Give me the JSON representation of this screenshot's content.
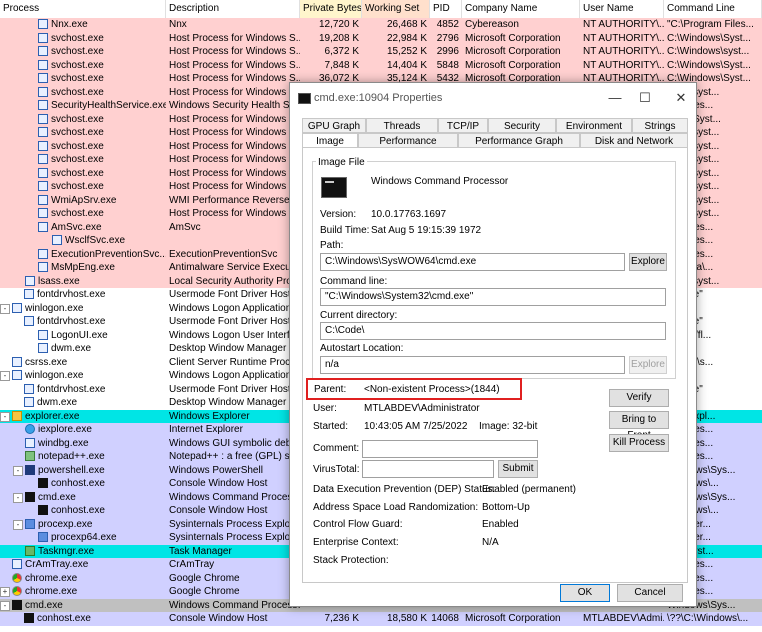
{
  "columns": {
    "process": "Process",
    "description": "Description",
    "private_bytes": "Private Bytes",
    "working_set": "Working Set",
    "pid": "PID",
    "company": "Company Name",
    "user": "User Name",
    "cmdline": "Command Line"
  },
  "rows": [
    {
      "name": "Nnx.exe",
      "desc": "Nnx",
      "pb": "12,720 K",
      "ws": "26,468 K",
      "pid": "4852",
      "company": "Cybereason",
      "user": "NT AUTHORITY\\...",
      "cmd": "\"C:\\Program Files..."
    },
    {
      "name": "svchost.exe",
      "desc": "Host Process for Windows S...",
      "pb": "19,208 K",
      "ws": "22,984 K",
      "pid": "2796",
      "company": "Microsoft Corporation",
      "user": "NT AUTHORITY\\...",
      "cmd": "C:\\Windows\\Syst..."
    },
    {
      "name": "svchost.exe",
      "desc": "Host Process for Windows S...",
      "pb": "6,372 K",
      "ws": "15,252 K",
      "pid": "2996",
      "company": "Microsoft Corporation",
      "user": "NT AUTHORITY\\...",
      "cmd": "C:\\Windows\\syst..."
    },
    {
      "name": "svchost.exe",
      "desc": "Host Process for Windows S...",
      "pb": "7,848 K",
      "ws": "14,404 K",
      "pid": "5848",
      "company": "Microsoft Corporation",
      "user": "NT AUTHORITY\\...",
      "cmd": "C:\\Windows\\Syst..."
    },
    {
      "name": "svchost.exe",
      "desc": "Host Process for Windows S...",
      "pb": "36,072 K",
      "ws": "35,124 K",
      "pid": "5432",
      "company": "Microsoft Corporation",
      "user": "NT AUTHORITY\\...",
      "cmd": "C:\\Windows\\Syst..."
    },
    {
      "name": "svchost.exe",
      "desc": "Host Process for Windows S...",
      "pb": "",
      "ws": "",
      "pid": "",
      "company": "",
      "user": "",
      "cmd": "dows\\syst..."
    },
    {
      "name": "SecurityHealthService.exe",
      "desc": "Windows Security Health S...",
      "pb": "",
      "ws": "",
      "pid": "",
      "company": "",
      "user": "",
      "cmd": "am Files..."
    },
    {
      "name": "svchost.exe",
      "desc": "Host Process for Windows S...",
      "pb": "",
      "ws": "",
      "pid": "",
      "company": "",
      "user": "",
      "cmd": "dows\\Syst..."
    },
    {
      "name": "svchost.exe",
      "desc": "Host Process for Windows S...",
      "pb": "",
      "ws": "",
      "pid": "",
      "company": "",
      "user": "",
      "cmd": "dows\\syst..."
    },
    {
      "name": "svchost.exe",
      "desc": "Host Process for Windows S...",
      "pb": "",
      "ws": "",
      "pid": "",
      "company": "",
      "user": "",
      "cmd": "dows\\syst..."
    },
    {
      "name": "svchost.exe",
      "desc": "Host Process for Windows S...",
      "pb": "",
      "ws": "",
      "pid": "",
      "company": "",
      "user": "",
      "cmd": "dows\\syst..."
    },
    {
      "name": "svchost.exe",
      "desc": "Host Process for Windows S...",
      "pb": "",
      "ws": "",
      "pid": "",
      "company": "",
      "user": "",
      "cmd": "dows\\syst..."
    },
    {
      "name": "svchost.exe",
      "desc": "Host Process for Windows S...",
      "pb": "",
      "ws": "",
      "pid": "",
      "company": "",
      "user": "",
      "cmd": "dows\\syst..."
    },
    {
      "name": "WmiApSrv.exe",
      "desc": "WMI Performance Reverse ...",
      "pb": "",
      "ws": "",
      "pid": "",
      "company": "",
      "user": "",
      "cmd": "dows\\syst..."
    },
    {
      "name": "svchost.exe",
      "desc": "Host Process for Windows S...",
      "pb": "",
      "ws": "",
      "pid": "",
      "company": "",
      "user": "",
      "cmd": "dows\\syst..."
    },
    {
      "name": "AmSvc.exe",
      "desc": "AmSvc",
      "pb": "",
      "ws": "",
      "pid": "",
      "company": "",
      "user": "",
      "cmd": "am Files..."
    },
    {
      "name": "WsclfSvc.exe",
      "desc": "",
      "pb": "",
      "ws": "",
      "pid": "",
      "company": "",
      "user": "",
      "cmd": "am Files..."
    },
    {
      "name": "ExecutionPreventionSvc....",
      "desc": "ExecutionPreventionSvc",
      "pb": "",
      "ws": "",
      "pid": "",
      "company": "",
      "user": "",
      "cmd": "am Files..."
    },
    {
      "name": "MsMpEng.exe",
      "desc": "Antimalware Service Execut...",
      "pb": "",
      "ws": "",
      "pid": "",
      "company": "",
      "user": "",
      "cmd": "amData\\..."
    },
    {
      "name": "lsass.exe",
      "desc": "Local Security Authority Proc...",
      "pb": "",
      "ws": "",
      "pid": "",
      "company": "",
      "user": "",
      "cmd": "dows\\syst..."
    },
    {
      "name": "fontdrvhost.exe",
      "desc": "Usermode Font Driver Host",
      "pb": "",
      "ws": "",
      "pid": "",
      "company": "",
      "user": "",
      "cmd": "ost.exe\""
    },
    {
      "name": "winlogon.exe",
      "desc": "Windows Logon Application",
      "pb": "",
      "ws": "",
      "pid": "",
      "company": "",
      "user": "",
      "cmd": "exe"
    },
    {
      "name": "fontdrvhost.exe",
      "desc": "Usermode Font Driver Host",
      "pb": "",
      "ws": "",
      "pid": "",
      "company": "",
      "user": "",
      "cmd": "ost.exe\""
    },
    {
      "name": "LogonUI.exe",
      "desc": "Windows Logon User Interfa...",
      "pb": "",
      "ws": "",
      "pid": "",
      "company": "",
      "user": "",
      "cmd": "I.exe\" /fl..."
    },
    {
      "name": "dwm.exe",
      "desc": "Desktop Window Manager",
      "pb": "",
      "ws": "",
      "pid": "",
      "company": "",
      "user": "",
      "cmd": "xe\""
    },
    {
      "name": "csrss.exe",
      "desc": "Client Server Runtime Process",
      "pb": "",
      "ws": "",
      "pid": "",
      "company": "",
      "user": "",
      "cmd": "Root%\\s..."
    },
    {
      "name": "winlogon.exe",
      "desc": "Windows Logon Application",
      "pb": "",
      "ws": "",
      "pid": "",
      "company": "",
      "user": "",
      "cmd": "exe"
    },
    {
      "name": "fontdrvhost.exe",
      "desc": "Usermode Font Driver Host",
      "pb": "",
      "ws": "",
      "pid": "",
      "company": "",
      "user": "",
      "cmd": "ost.exe\""
    },
    {
      "name": "dwm.exe",
      "desc": "Desktop Window Manager",
      "pb": "",
      "ws": "",
      "pid": "",
      "company": "",
      "user": "",
      "cmd": "xe\""
    },
    {
      "name": "explorer.exe",
      "desc": "Windows Explorer",
      "pb": "",
      "ws": "",
      "pid": "",
      "company": "",
      "user": "",
      "cmd": "ows\\Expl..."
    },
    {
      "name": "iexplore.exe",
      "desc": "Internet Explorer",
      "pb": "",
      "ws": "",
      "pid": "",
      "company": "",
      "user": "",
      "cmd": "am Files..."
    },
    {
      "name": "windbg.exe",
      "desc": "Windows GUI symbolic debu...",
      "pb": "",
      "ws": "",
      "pid": "",
      "company": "",
      "user": "",
      "cmd": "am Files..."
    },
    {
      "name": "notepad++.exe",
      "desc": "Notepad++ : a free (GPL) so...",
      "pb": "",
      "ws": "",
      "pid": "",
      "company": "",
      "user": "",
      "cmd": "am Files..."
    },
    {
      "name": "powershell.exe",
      "desc": "Windows PowerShell",
      "pb": "",
      "ws": "",
      "pid": "",
      "company": "",
      "user": "",
      "cmd": "Windows\\Sys..."
    },
    {
      "name": "conhost.exe",
      "desc": "Console Window Host",
      "pb": "",
      "ws": "",
      "pid": "",
      "company": "",
      "user": "",
      "cmd": "Windows\\..."
    },
    {
      "name": "cmd.exe",
      "desc": "Windows Command Processor",
      "pb": "",
      "ws": "",
      "pid": "",
      "company": "",
      "user": "",
      "cmd": "Windows\\Sys..."
    },
    {
      "name": "conhost.exe",
      "desc": "Console Window Host",
      "pb": "",
      "ws": "",
      "pid": "",
      "company": "",
      "user": "",
      "cmd": "Windows\\..."
    },
    {
      "name": "procexp.exe",
      "desc": "Sysinternals Process Explorer",
      "pb": "",
      "ws": "",
      "pid": "",
      "company": "",
      "user": "",
      "cmd": "Sysinter..."
    },
    {
      "name": "procexp64.exe",
      "desc": "Sysinternals Process Explorer",
      "pb": "",
      "ws": "",
      "pid": "",
      "company": "",
      "user": "",
      "cmd": "Sysinter..."
    },
    {
      "name": "Taskmgr.exe",
      "desc": "Task Manager",
      "pb": "",
      "ws": "",
      "pid": "",
      "company": "",
      "user": "",
      "cmd": "ows\\syst..."
    },
    {
      "name": "CrAmTray.exe",
      "desc": "CrAmTray",
      "pb": "",
      "ws": "",
      "pid": "",
      "company": "",
      "user": "",
      "cmd": "am Files..."
    },
    {
      "name": "chrome.exe",
      "desc": "Google Chrome",
      "pb": "",
      "ws": "",
      "pid": "",
      "company": "",
      "user": "",
      "cmd": "am Files..."
    },
    {
      "name": "chrome.exe",
      "desc": "Google Chrome",
      "pb": "",
      "ws": "",
      "pid": "",
      "company": "",
      "user": "",
      "cmd": "am Files..."
    },
    {
      "name": "cmd.exe",
      "desc": "Windows Command Processor",
      "pb": "",
      "ws": "",
      "pid": "",
      "company": "",
      "user": "",
      "cmd": "Windows\\Sys..."
    },
    {
      "name": "conhost.exe",
      "desc": "Console Window Host",
      "pb": "7,236 K",
      "ws": "18,580 K",
      "pid": "14068",
      "company": "Microsoft Corporation",
      "user": "MTLABDEV\\Admi...",
      "cmd": "\\??\\C:\\Windows\\..."
    }
  ],
  "dialog": {
    "title": "cmd.exe:10904 Properties",
    "tabs_top": [
      "GPU Graph",
      "Threads",
      "TCP/IP",
      "Security",
      "Environment",
      "Strings"
    ],
    "tabs_bottom": [
      "Image",
      "Performance",
      "Performance Graph",
      "Disk and Network"
    ],
    "image_file_label": "Image File",
    "file_desc": "Windows Command Processor",
    "version_label": "Version:",
    "version": "10.0.17763.1697",
    "build_label": "Build Time:",
    "build": "Sat Aug  5 19:15:39 1972",
    "path_label": "Path:",
    "path": "C:\\Windows\\SysWOW64\\cmd.exe",
    "cmdline_label": "Command line:",
    "cmdline": "\"C:\\Windows\\System32\\cmd.exe\"",
    "curdir_label": "Current directory:",
    "curdir": "C:\\Code\\",
    "autostart_label": "Autostart Location:",
    "autostart": "n/a",
    "explore": "Explore",
    "parent_label": "Parent:",
    "parent": "<Non-existent Process>(1844)",
    "user_label": "User:",
    "user": "MTLABDEV\\Administrator",
    "started_label": "Started:",
    "started": "10:43:05 AM  7/25/2022",
    "image_bits": "Image: 32-bit",
    "comment_label": "Comment:",
    "virustotal_label": "VirusTotal:",
    "submit": "Submit",
    "verify": "Verify",
    "bring_front": "Bring to Front",
    "kill": "Kill Process",
    "dep_label": "Data Execution Prevention (DEP) Status:",
    "dep": "Enabled (permanent)",
    "aslr_label": "Address Space Load Randomization:",
    "aslr": "Bottom-Up",
    "cfg_label": "Control Flow Guard:",
    "cfg": "Enabled",
    "enterprise_label": "Enterprise Context:",
    "enterprise": "N/A",
    "stack_label": "Stack Protection:",
    "ok": "OK",
    "cancel": "Cancel",
    "minimize": "—",
    "maximize": "☐",
    "close": "✕"
  },
  "colors": {
    "service": "#ffd0d0",
    "user_proc": "#d0d0ff",
    "highlight": "#00e5e5",
    "selected": "#c0c0c0",
    "default": "#ffffff",
    "pb_col": "#fff5cc",
    "ws_col": "#ffe0cc"
  }
}
